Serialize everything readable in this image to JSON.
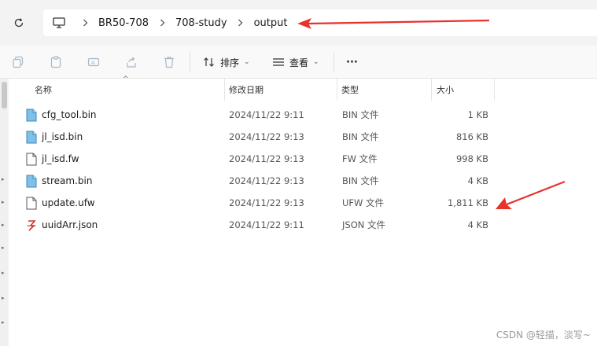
{
  "address": {
    "crumbs": [
      "BR50-708",
      "708-study",
      "output"
    ]
  },
  "toolbar": {
    "sort_label": "排序",
    "view_label": "查看",
    "more_label": "···"
  },
  "columns": {
    "name": "名称",
    "date": "修改日期",
    "type": "类型",
    "size": "大小"
  },
  "files": [
    {
      "name": "cfg_tool.bin",
      "date": "2024/11/22 9:11",
      "type": "BIN 文件",
      "size": "1 KB",
      "icon": "bin-file-icon"
    },
    {
      "name": "jl_isd.bin",
      "date": "2024/11/22 9:13",
      "type": "BIN 文件",
      "size": "816 KB",
      "icon": "bin-file-icon"
    },
    {
      "name": "jl_isd.fw",
      "date": "2024/11/22 9:13",
      "type": "FW 文件",
      "size": "998 KB",
      "icon": "generic-file-icon"
    },
    {
      "name": "stream.bin",
      "date": "2024/11/22 9:13",
      "type": "BIN 文件",
      "size": "4 KB",
      "icon": "bin-file-icon"
    },
    {
      "name": "update.ufw",
      "date": "2024/11/22 9:13",
      "type": "UFW 文件",
      "size": "1,811 KB",
      "icon": "generic-file-icon"
    },
    {
      "name": "uuidArr.json",
      "date": "2024/11/22 9:11",
      "type": "JSON 文件",
      "size": "4 KB",
      "icon": "json-file-icon"
    }
  ],
  "watermark": "CSDN @轻描，淡写~",
  "colors": {
    "annotation_arrow": "#e8322c",
    "bin_icon": "#5aa6d6"
  }
}
